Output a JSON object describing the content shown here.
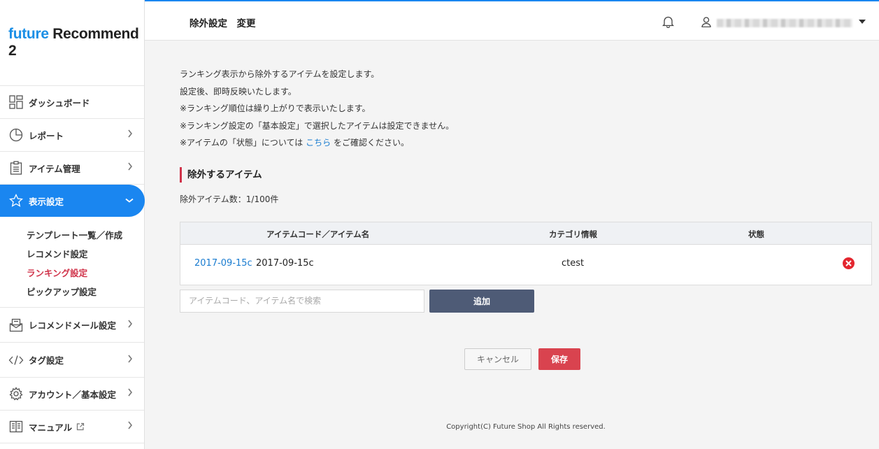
{
  "logo": {
    "future": "future",
    "rest": " Recommend 2"
  },
  "sidebar": {
    "items": [
      {
        "label": "ダッシュボード",
        "icon": "dashboard-icon"
      },
      {
        "label": "レポート",
        "icon": "pie-chart-icon"
      },
      {
        "label": "アイテム管理",
        "icon": "clipboard-icon"
      },
      {
        "label": "表示設定",
        "icon": "star-icon"
      },
      {
        "label": "レコメンドメール設定",
        "icon": "mail-icon"
      },
      {
        "label": "タグ設定",
        "icon": "code-icon"
      },
      {
        "label": "アカウント／基本設定",
        "icon": "gear-icon"
      },
      {
        "label": "マニュアル",
        "icon": "book-icon"
      }
    ],
    "subitems": [
      {
        "label": "テンプレート一覧／作成"
      },
      {
        "label": "レコメンド設定"
      },
      {
        "label": "ランキング設定"
      },
      {
        "label": "ピックアップ設定"
      }
    ]
  },
  "header": {
    "title": "除外設定　変更"
  },
  "main": {
    "desc": [
      "ランキング表示から除外するアイテムを設定します。",
      "設定後、即時反映いたします。",
      "※ランキング順位は繰り上がりで表示いたします。",
      "※ランキング設定の「基本設定」で選択したアイテムは設定できません。"
    ],
    "desc_last_prefix": "※アイテムの「状態」については",
    "desc_link": "こちら",
    "desc_last_suffix": "をご確認ください。",
    "section_title": "除外するアイテム",
    "count_text": "除外アイテム数：1/100件",
    "table": {
      "headers": [
        "アイテムコード／アイテム名",
        "カテゴリ情報",
        "状態"
      ],
      "rows": [
        {
          "code": "2017-09-15c",
          "name": "2017-09-15c",
          "category": "ctest",
          "status": ""
        }
      ]
    },
    "search_placeholder": "アイテムコード、アイテム名で検索",
    "add_label": "追加",
    "cancel_label": "キャンセル",
    "save_label": "保存"
  },
  "footer": "Copyright(C) Future Shop All Rights reserved.",
  "colors": {
    "accent": "#1a86f0",
    "danger": "#d9434f",
    "current": "#d0334a"
  }
}
